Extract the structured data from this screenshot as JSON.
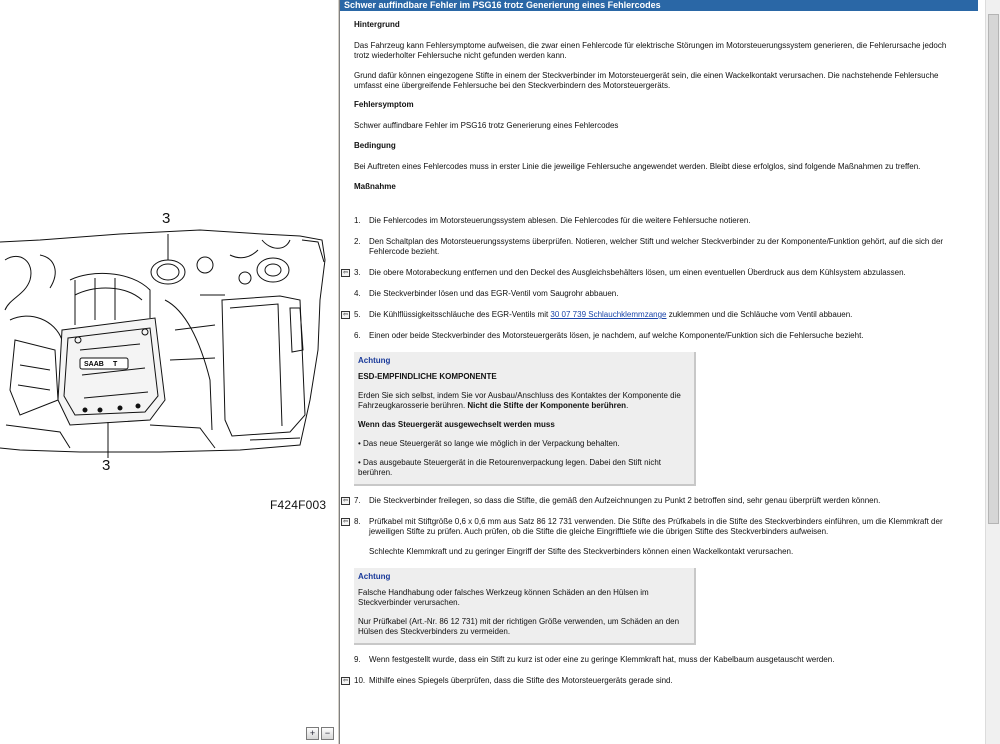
{
  "figure": {
    "callout_top": "3",
    "callout_bottom": "3",
    "code": "F424F003",
    "badge_text": "SAAB",
    "badge_suffix": "T",
    "zoom_in_label": "+",
    "zoom_out_label": "−"
  },
  "doc": {
    "header": "Schwer auffindbare Fehler im PSG16 trotz Generierung eines Fehlercodes",
    "background_title": "Hintergrund",
    "background_p1": "Das Fahrzeug kann Fehlersymptome aufweisen, die zwar einen Fehlercode für elektrische Störungen im Motorsteuerungssystem generieren, die Fehlerursache jedoch trotz wiederholter Fehlersuche nicht gefunden werden kann.",
    "background_p2": "Grund dafür können eingezogene Stifte in einem der Steckverbinder im Motorsteuergerät sein, die einen Wackelkontakt verursachen. Die nachstehende Fehlersuche umfasst eine übergreifende Fehlersuche bei den Steckverbindern des Motorsteuergeräts.",
    "symptom_title": "Fehlersymptom",
    "symptom_text": "Schwer auffindbare Fehler im PSG16 trotz Generierung eines Fehlercodes",
    "condition_title": "Bedingung",
    "condition_text": "Bei Auftreten eines Fehlercodes muss in erster Linie die jeweilige Fehlersuche angewendet werden. Bleibt diese erfolglos, sind folgende Maßnahmen zu treffen.",
    "measure_title": "Maßnahme",
    "steps": [
      {
        "num": "1.",
        "text": "Die Fehlercodes im Motorsteuerungssystem ablesen. Die Fehlercodes für die weitere Fehlersuche notieren."
      },
      {
        "num": "2.",
        "text": "Den Schaltplan des Motorsteuerungssystems überprüfen. Notieren, welcher Stift und welcher Steckverbinder zu der Komponente/Funktion gehört, auf die sich der Fehlercode bezieht."
      },
      {
        "num": "3.",
        "text": "Die obere Motorabeckung entfernen und den Deckel des Ausgleichsbehälters lösen, um einen eventuellen Überdruck aus dem Kühlsystem abzulassen."
      },
      {
        "num": "4.",
        "text": "Die Steckverbinder lösen und das EGR-Ventil vom Saugrohr abbauen."
      },
      {
        "num": "5.",
        "text_before": "Die Kühlflüssigkeitsschläuche des EGR-Ventils mit ",
        "link": "30 07 739 Schlauchklemmzange",
        "text_after": " zuklemmen und die Schläuche vom Ventil abbauen."
      },
      {
        "num": "6.",
        "text": "Einen oder beide Steckverbinder des Motorsteuergeräts lösen, je nachdem, auf welche Komponente/Funktion sich die Fehlersuche bezieht."
      },
      {
        "num": "7.",
        "text": "Die Steckverbinder freilegen, so dass die Stifte, die gemäß den Aufzeichnungen zu Punkt 2 betroffen sind, sehr genau überprüft werden können."
      },
      {
        "num": "8.",
        "text": "Prüfkabel mit Stiftgröße 0,6 x 0,6 mm aus Satz 86 12 731 verwenden. Die Stifte des Prüfkabels in die Stifte des Steckverbinders einführen, um die Klemmkraft der jeweiligen Stifte zu prüfen. Auch prüfen, ob die Stifte die gleiche Eingrifftiefe wie die übrigen Stifte des Steckverbinders aufweisen.",
        "extra": "Schlechte Klemmkraft und zu geringer Eingriff der Stifte des Steckverbinders können einen Wackelkontakt verursachen."
      },
      {
        "num": "9.",
        "text": "Wenn festgestellt wurde, dass ein Stift zu kurz ist oder eine zu geringe Klemmkraft hat, muss der Kabelbaum ausgetauscht werden."
      },
      {
        "num": "10.",
        "text": "Mithilfe eines Spiegels überprüfen, dass die Stifte des Motorsteuergeräts gerade sind."
      }
    ],
    "warning1": {
      "title": "Achtung",
      "subtitle": "ESD-EMPFINDLICHE KOMPONENTE",
      "text_before": "Erden Sie sich selbst, indem Sie vor Ausbau/Anschluss des Kontaktes der Komponente die Fahrzeugkarosserie berühren. ",
      "text_bold": "Nicht die Stifte der Komponente berühren",
      "text_after": ".",
      "sub2": "Wenn das Steuergerät ausgewechselt werden muss",
      "bullet1": "• Das neue Steuergerät so lange wie möglich in der Verpackung behalten.",
      "bullet2": "• Das ausgebaute Steuergerät in die Retourenverpackung legen. Dabei den Stift nicht berühren."
    },
    "warning2": {
      "title": "Achtung",
      "text1": "Falsche Handhabung oder falsches Werkzeug können Schäden an den Hülsen im Steckverbinder verursachen.",
      "text2": "Nur Prüfkabel (Art.-Nr. 86 12 731) mit der richtigen Größe verwenden, um Schäden an den Hülsen des Steckverbinders zu vermeiden."
    }
  },
  "colors": {
    "header_bg": "#2a67a6",
    "link": "#1b45a8",
    "warn_title": "#1a3a9a"
  }
}
